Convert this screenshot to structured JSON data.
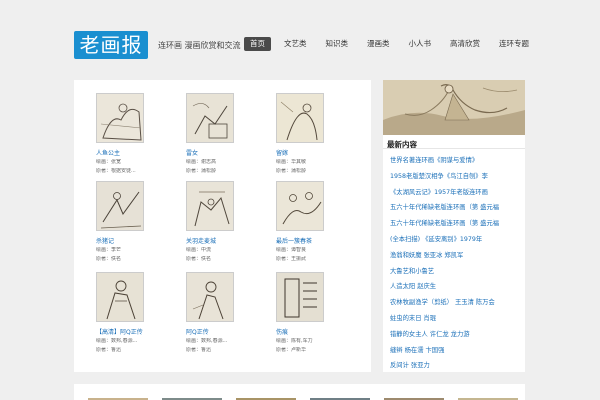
{
  "header": {
    "logo": "老画报",
    "slogan": "连环画 漫画欣赏和交流"
  },
  "nav": {
    "items": [
      {
        "label": "首页",
        "active": true
      },
      {
        "label": "文艺类"
      },
      {
        "label": "知识类"
      },
      {
        "label": "漫画类"
      },
      {
        "label": "小人书"
      },
      {
        "label": "高清欣赏"
      },
      {
        "label": "连环专题"
      }
    ]
  },
  "gallery": {
    "cards": [
      {
        "title": "人鱼公主",
        "meta1": "绘画：张宽",
        "meta2": "原著：根据安徒..."
      },
      {
        "title": "雷女",
        "meta1": "绘画：谢志高",
        "meta2": "原著：蒲松龄"
      },
      {
        "title": "留嫁",
        "meta1": "绘画：华其敏",
        "meta2": "原著：蒲松龄"
      },
      {
        "title": "杀猪记",
        "meta1": "绘画：李芒",
        "meta2": "原著：佚名"
      },
      {
        "title": "关羽走麦城",
        "meta1": "绘画：中流",
        "meta2": "原著：佚名"
      },
      {
        "title": "最后一簇春茶",
        "meta1": "绘画：谭智良",
        "meta2": "原著：王振武"
      },
      {
        "title": "【高清】阿Q正传",
        "meta1": "绘画：数邦,春源...",
        "meta2": "原著：鲁迅"
      },
      {
        "title": "阿Q正传",
        "meta1": "绘画：数邦,春源...",
        "meta2": "原著：鲁迅"
      },
      {
        "title": "伤痕",
        "meta1": "绘画：陈有,车力",
        "meta2": "原著：卢新华"
      }
    ]
  },
  "latest": {
    "title": "最新内容",
    "items": [
      "世界名著连环画《阴谋与爱情》",
      "1958老版楚汉相争《鸟江自刎》李",
      "《太湖风云记》1957年老版连环画",
      "五六十年代稀缺老版连环画（第 盛元福",
      "五六十年代稀缺老版连环画（第 盛元福",
      "(全本扫描) 《延安离别》1979年",
      "渔翁和妖魔 张亚冰 郑凯军",
      "大鲁艺和小鲁艺",
      "人造太阳 赵庆生",
      "农林牧副渔学（剪纸） 王玉清 陈万会",
      "蛀虫的末日 肖琨",
      "错静的女主人 许仁龙 龙力游",
      "缝辫 杨在濡 卞国强",
      "反间计 张亚力"
    ]
  },
  "colors": {
    "brand": "#1a8fd0",
    "link": "#1a6fb8",
    "nav_active": "#4a4a4a"
  }
}
